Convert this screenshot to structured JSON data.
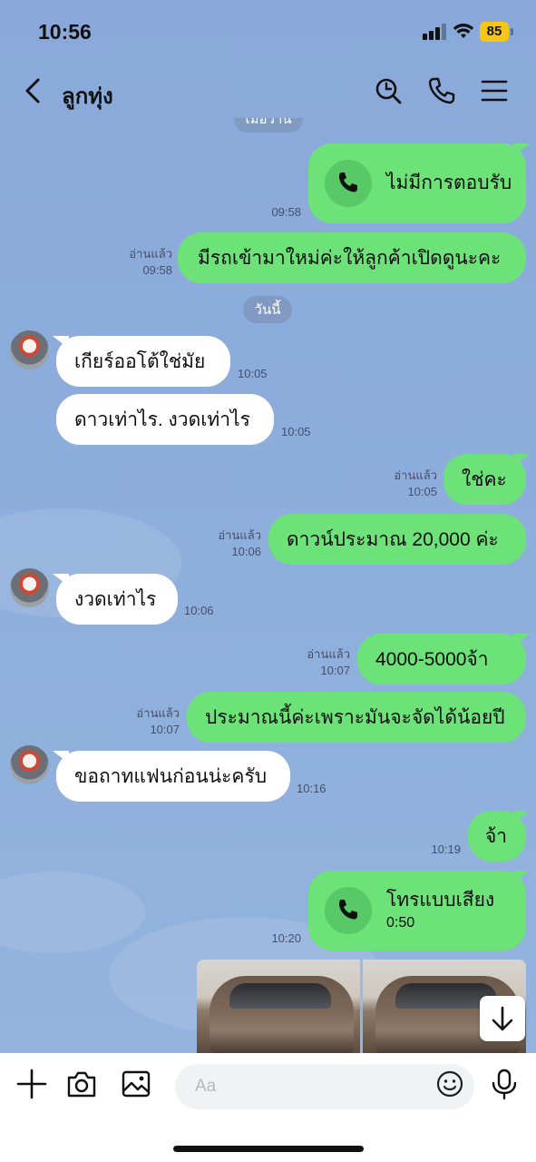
{
  "status_bar": {
    "time": "10:56",
    "battery": "85"
  },
  "header": {
    "title": "ลูกทุ่ง",
    "icons": [
      "back-chevron-icon",
      "search-icon",
      "phone-icon",
      "menu-icon"
    ]
  },
  "date_labels": {
    "yesterday": "เมื่อวาน",
    "today": "วันนี้"
  },
  "messages": [
    {
      "dir": "out",
      "type": "call",
      "text": "ไม่มีการตอบรับ",
      "time": "09:58"
    },
    {
      "dir": "out",
      "text": "มีรถเข้ามาใหม่ค่ะให้ลูกค้าเปิดดูนะคะ",
      "read": "อ่านแล้ว",
      "time": "09:58"
    },
    {
      "dir": "in",
      "text": "เกียร์ออโต้ใช่มัย",
      "time": "10:05"
    },
    {
      "dir": "in",
      "text": "ดาวเท่าไร. งวดเท่าไร",
      "time": "10:05"
    },
    {
      "dir": "out",
      "text": "ใช่คะ",
      "read": "อ่านแล้ว",
      "time": "10:05"
    },
    {
      "dir": "out",
      "text": "ดาวน์ประมาณ 20,000 ค่ะ",
      "read": "อ่านแล้ว",
      "time": "10:06"
    },
    {
      "dir": "in",
      "text": "งวดเท่าไร",
      "time": "10:06"
    },
    {
      "dir": "out",
      "text": "4000-5000จ้า",
      "read": "อ่านแล้ว",
      "time": "10:07"
    },
    {
      "dir": "out",
      "text": "ประมาณนี้ค่ะเพราะมันจะจัดได้น้อยปี",
      "read": "อ่านแล้ว",
      "time": "10:07"
    },
    {
      "dir": "in",
      "text": "ขอถาทแฟนก่อนน่ะครับ",
      "time": "10:16"
    },
    {
      "dir": "out",
      "text": "จ้า",
      "time": "10:19"
    },
    {
      "dir": "out",
      "type": "call",
      "text": "โทรแบบเสียง",
      "duration": "0:50",
      "time": "10:20"
    }
  ],
  "input": {
    "placeholder": "Aa"
  },
  "colors": {
    "outgoing_bubble": "#6de279",
    "incoming_bubble": "#ffffff",
    "chat_background": "#8dabd9",
    "battery": "#f5c518"
  }
}
